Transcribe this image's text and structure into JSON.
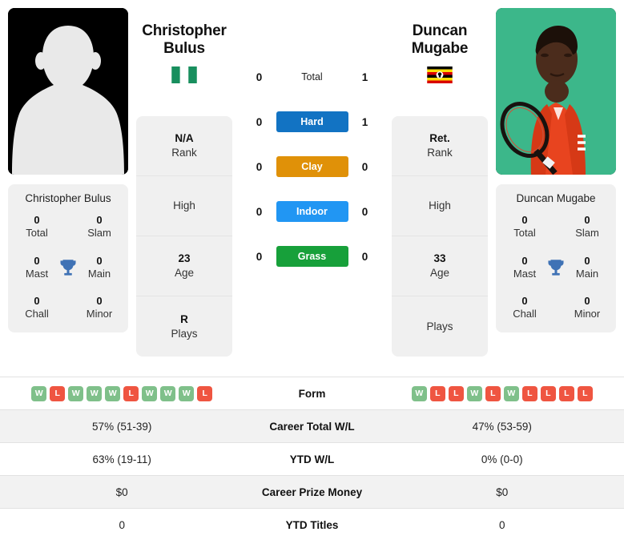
{
  "players": {
    "left": {
      "first_name": "Christopher",
      "last_name": "Bulus",
      "full_name": "Christopher Bulus",
      "photo_type": "placeholder-silhouette",
      "flag": "nigeria",
      "rank": "N/A",
      "rank_label": "Rank",
      "high": "",
      "high_label": "High",
      "age": "23",
      "age_label": "Age",
      "plays": "R",
      "plays_label": "Plays",
      "titles": {
        "total": "0",
        "total_label": "Total",
        "slam": "0",
        "slam_label": "Slam",
        "mast": "0",
        "mast_label": "Mast",
        "main": "0",
        "main_label": "Main",
        "chall": "0",
        "chall_label": "Chall",
        "minor": "0",
        "minor_label": "Minor"
      },
      "form": [
        "W",
        "L",
        "W",
        "W",
        "W",
        "L",
        "W",
        "W",
        "W",
        "L"
      ],
      "career_wl": "57% (51-39)",
      "ytd_wl": "63% (19-11)",
      "career_prize_money": "$0",
      "ytd_titles": "0"
    },
    "right": {
      "first_name": "Duncan",
      "last_name": "Mugabe",
      "full_name": "Duncan Mugabe",
      "photo_type": "player-photo",
      "flag": "uganda",
      "rank": "Ret.",
      "rank_label": "Rank",
      "high": "",
      "high_label": "High",
      "age": "33",
      "age_label": "Age",
      "plays": "",
      "plays_label": "Plays",
      "titles": {
        "total": "0",
        "total_label": "Total",
        "slam": "0",
        "slam_label": "Slam",
        "mast": "0",
        "mast_label": "Mast",
        "main": "0",
        "main_label": "Main",
        "chall": "0",
        "chall_label": "Chall",
        "minor": "0",
        "minor_label": "Minor"
      },
      "form": [
        "W",
        "L",
        "L",
        "W",
        "L",
        "W",
        "L",
        "L",
        "L",
        "L"
      ],
      "career_wl": "47% (53-59)",
      "ytd_wl": "0% (0-0)",
      "career_prize_money": "$0",
      "ytd_titles": "0"
    }
  },
  "head_to_head": [
    {
      "label": "Total",
      "left": "0",
      "right": "1",
      "badge": false,
      "color": ""
    },
    {
      "label": "Hard",
      "left": "0",
      "right": "1",
      "badge": true,
      "color": "#1273c3"
    },
    {
      "label": "Clay",
      "left": "0",
      "right": "0",
      "badge": true,
      "color": "#e09108"
    },
    {
      "label": "Indoor",
      "left": "0",
      "right": "0",
      "badge": true,
      "color": "#2196f3"
    },
    {
      "label": "Grass",
      "left": "0",
      "right": "0",
      "badge": true,
      "color": "#17a03a"
    }
  ],
  "stats_rows": [
    {
      "label": "Form",
      "key": "form",
      "type": "form"
    },
    {
      "label": "Career Total W/L",
      "key": "career_wl",
      "type": "text"
    },
    {
      "label": "YTD W/L",
      "key": "ytd_wl",
      "type": "text"
    },
    {
      "label": "Career Prize Money",
      "key": "career_prize_money",
      "type": "text"
    },
    {
      "label": "YTD Titles",
      "key": "ytd_titles",
      "type": "text"
    }
  ],
  "colors": {
    "hard": "#1273c3",
    "clay": "#e09108",
    "indoor": "#2196f3",
    "grass": "#17a03a",
    "win_badge": "#7fc08a",
    "loss_badge": "#ef5541",
    "card_bg": "#f0f0f0",
    "row_alt_bg": "#f2f2f2"
  }
}
